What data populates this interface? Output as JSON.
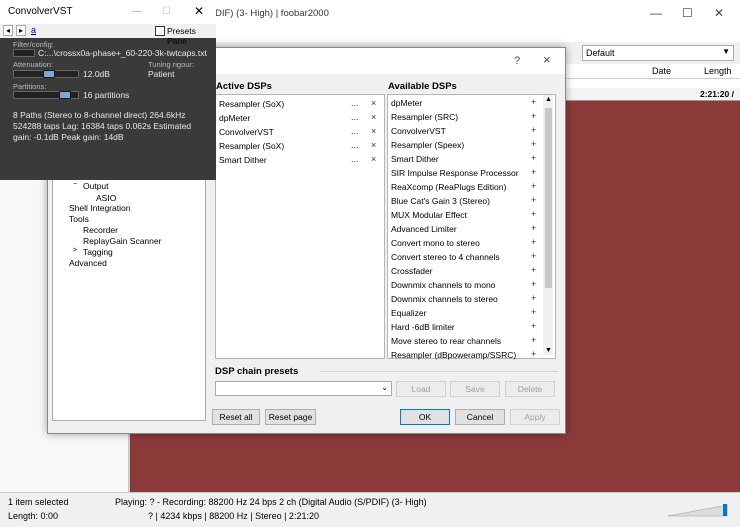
{
  "main": {
    "title_fragment": "DIF) (3- High) | foobar2000",
    "combo_value": "Default",
    "columns": [
      "Date",
      "Length"
    ],
    "playlist_time": "2:21:20 /",
    "status": {
      "selected": "1 item selected",
      "length": "Length: 0:00",
      "playing": "Playing:  ? - Recording: 88200 Hz 24 bps 2 ch (Digital Audio (S/PDIF) (3- High)",
      "info": "? | 4234 kbps | 88200 Hz | Stereo | 2:21:20"
    }
  },
  "dialog": {
    "help": "?",
    "close": "×",
    "tree": [
      "Output",
      "ASIO",
      "Shell Integration",
      "Tools",
      "Recorder",
      "ReplayGain Scanner",
      "Tagging",
      "Advanced"
    ],
    "active_label": "Active DSPs",
    "available_label": "Available DSPs",
    "active_dsps": [
      "Resampler (SoX)",
      "dpMeter",
      "ConvolverVST",
      "Resampler (SoX)",
      "Smart Dither"
    ],
    "available_dsps": [
      "dpMeter",
      "Resampler (SRC)",
      "ConvolverVST",
      "Resampler (Speex)",
      "Smart Dither",
      "SIR Impulse Response Processor",
      "ReaXcomp (ReaPlugs Edition)",
      "Blue Cat's Gain 3 (Stereo)",
      "MUX Modular Effect",
      "Advanced Limiter",
      "Convert mono to stereo",
      "Convert stereo to 4 channels",
      "Crossfader",
      "Downmix channels to mono",
      "Downmix channels to stereo",
      "Equalizer",
      "Hard -6dB limiter",
      "Move stereo to rear channels",
      "Resampler (dBpoweramp/SSRC)"
    ],
    "row_more": "...",
    "row_remove": "×",
    "row_add": "+",
    "chain_presets_label": "DSP chain presets",
    "load": "Load",
    "save": "Save",
    "delete": "Delete",
    "reset_all": "Reset all",
    "reset_page": "Reset page",
    "ok": "OK",
    "cancel": "Cancel",
    "apply": "Apply"
  },
  "convolver": {
    "title": "ConvolverVST",
    "nav_text": "a",
    "presets_pane": "Presets Pane",
    "filter_label": "Filter/config:",
    "filter_value": "C:...\\crossx0a-phase+_60-220-3k-twtcaps.txt",
    "attenuation_label": "Attenuation:",
    "attenuation_value": "12.0dB",
    "attenuation_level": 0.55,
    "tuning_label": "Tuning rigour:",
    "tuning_value": "Patient",
    "partitions_label": "Partitions:",
    "partitions_value": "16 partitions",
    "partitions_level": 0.85,
    "info1": "8 Paths (Stereo to 8-channel direct) 264.6kHz",
    "info2": "524288 taps Lag: 16384 taps 0.062s Estimated",
    "info3": "gain: -0.1dB Peak gain: 14dB"
  },
  "colors": {
    "playlist_bg": "#8b3a3a",
    "convolver_bg": "#3a3a3a",
    "accent": "#0078d7"
  }
}
